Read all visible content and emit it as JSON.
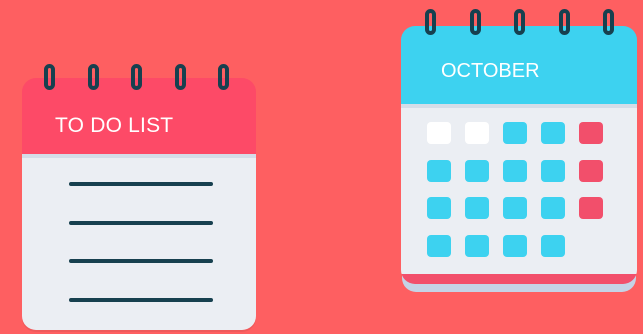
{
  "colors": {
    "background": "#fe5f61",
    "todo_header": "#fd4a67",
    "page_body": "#ebeef3",
    "ink": "#17404f",
    "calendar_header": "#3dd2f0",
    "calendar_bottom": "#f24f6b",
    "calendar_back": "#c5d3e6",
    "day_white": "#ffffff",
    "day_blue": "#3dd2f0",
    "day_red": "#f24f6b"
  },
  "todo": {
    "title": "TO DO LIST",
    "ring_count": 5,
    "line_count": 4
  },
  "calendar": {
    "title": "OCTOBER",
    "ring_count": 5,
    "days": [
      [
        "white",
        "white",
        "blue",
        "blue",
        "red"
      ],
      [
        "blue",
        "blue",
        "blue",
        "blue",
        "red"
      ],
      [
        "blue",
        "blue",
        "blue",
        "blue",
        "red"
      ],
      [
        "blue",
        "blue",
        "blue",
        "blue"
      ]
    ]
  }
}
